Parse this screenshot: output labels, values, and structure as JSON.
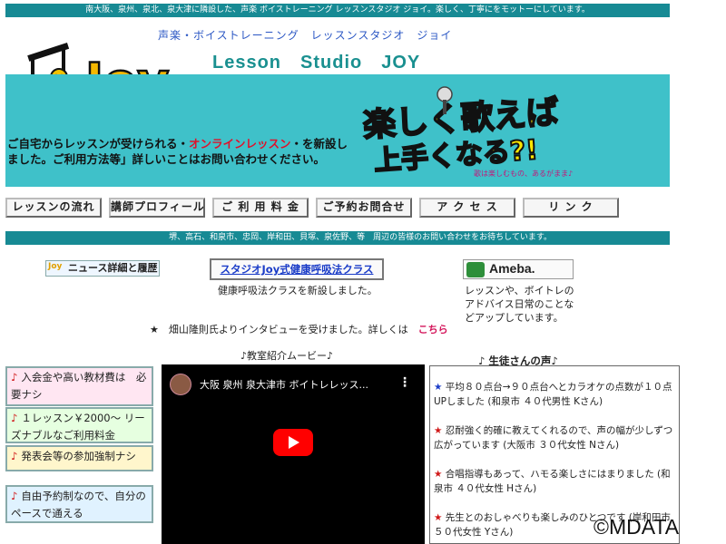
{
  "header": {
    "topbar_text": "南大阪、泉州、泉北、泉大津に隣設した、声楽 ボイストレーニング レッスンスタジオ ジョイ。楽しく、丁寧にをモットーにしています。",
    "subtitle": "声楽・ボイストレーニング　レッスンスタジオ　ジョイ",
    "title": "Lesson　Studio　JOY",
    "logo_text": "Joy"
  },
  "banner": {
    "line_before": "ご自宅からレッスンが受けられる・",
    "highlight": "オンラインレッスン",
    "line_after": "・を新設しました。ご利用方法等」詳しいことはお問い合わせください。",
    "art_line1": "楽しく歌えば",
    "art_line2": "上手くなる?!",
    "art_small": "歌は楽しむもの、あるがまま♪"
  },
  "nav": [
    {
      "label": "レッスンの流れ"
    },
    {
      "label": "講師プロフィール"
    },
    {
      "label": "ご 利 用 料 金"
    },
    {
      "label": "ご予約お問合せ"
    },
    {
      "label": "ア ク セ ス"
    },
    {
      "label": "リ ン ク"
    }
  ],
  "midbar_text": "堺、高石、和泉市、忠岡、岸和田、貝塚、泉佐野、等　周辺の皆様のお問い合わせをお待ちしています。",
  "links": {
    "news_logo": "Joy",
    "news_label": "ニュース詳細と履歴",
    "breath_label": "スタジオJoy式健康呼吸法クラス",
    "breath_note": "健康呼吸法クラスを新設しました。",
    "ameba_label": "Ameba.",
    "ameba_desc": "レッスンや、ボイトレのアドバイス日常のことなどアップしています。"
  },
  "interview": {
    "text": "★　畑山隆則氏よりインタビューを受けました。詳しくは　",
    "link": "こちら"
  },
  "movie": {
    "heading": "♪教室紹介ムービー♪",
    "title": "大阪 泉州 泉大津市 ボイトレレッス...",
    "more": "⋮"
  },
  "features": [
    {
      "icon": "♪",
      "text": "入会金や高い教材費は　必要ナシ",
      "bg": "#ffe6f2"
    },
    {
      "icon": "♪",
      "text": "１レッスン￥2000～ リーズナブルなご利用料金",
      "bg": "#e6ffe0"
    },
    {
      "icon": "♪",
      "text": "発表会等の参加強制ナシ",
      "bg": "#fff6cc"
    },
    {
      "icon": "♪",
      "text": "自由予約制なので、自分のペースで通える",
      "bg": "#e0f2ff"
    }
  ],
  "voices": {
    "heading": "♪ 生徒さんの声♪",
    "items": [
      {
        "star": "★",
        "star_color": "#1a3cc8",
        "text": "平均８０点台→９０点台へとカラオケの点数が１０点UPしました (和泉市 ４０代男性 Kさん)"
      },
      {
        "star": "★",
        "star_color": "#d01818",
        "text": "忍耐強く的確に教えてくれるので、声の幅が少しずつ広がっています (大阪市 ３０代女性 Nさん)"
      },
      {
        "star": "★",
        "star_color": "#d01818",
        "text": "合唱指導もあって、ハモる楽しさにはまりました (和泉市 ４０代女性 Hさん)"
      },
      {
        "star": "★",
        "star_color": "#d01818",
        "text": "先生とのおしゃべりも楽しみのひとつです (岸和田市 ５０代女性 Yさん)"
      }
    ]
  },
  "watermark": "©MDATA"
}
